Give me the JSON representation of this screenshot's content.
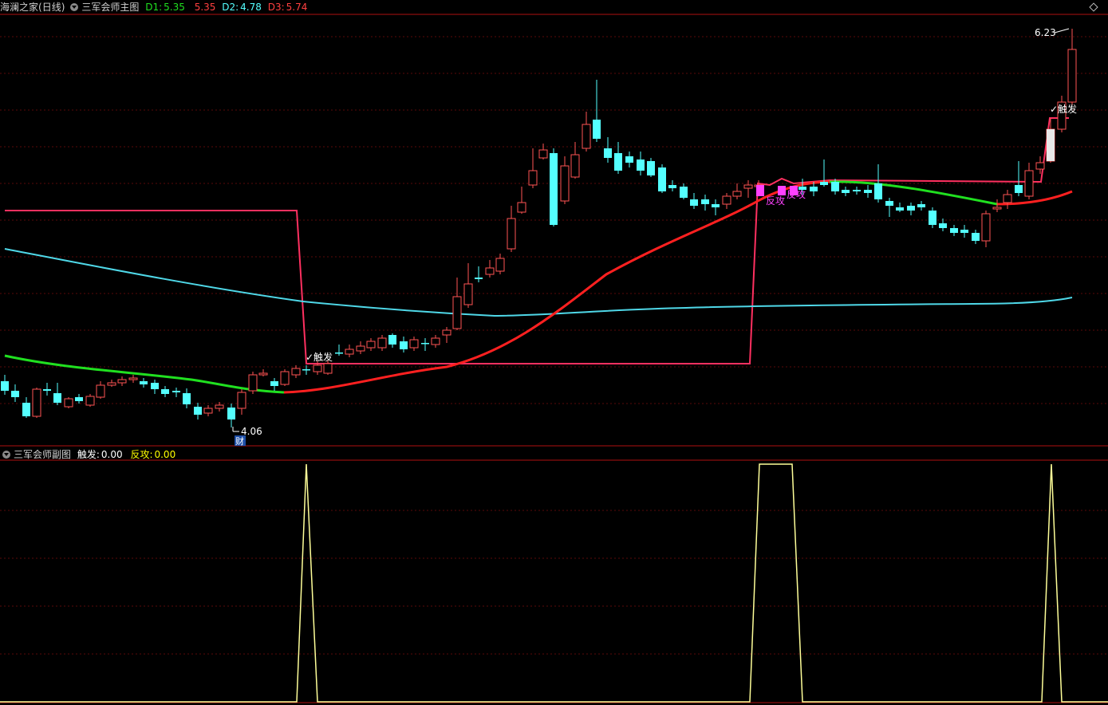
{
  "colors": {
    "background": "#000000",
    "grid": "#5a0a0a",
    "divider": "#b01010",
    "candle_up": "#ff5353",
    "candle_down": "#54ffff",
    "ma_slow": "#4fd8e8",
    "ma_fast_up": "#ff2020",
    "ma_fast_green": "#20e020",
    "stair_line": "#ff3060",
    "sub_line": "#ffff99",
    "d1": "#20e020",
    "d2": "#54ffff",
    "d3": "#ff4040",
    "chudfa": "#ffffff",
    "fangong": "#ffff00"
  },
  "main_header": {
    "stock_name": "海澜之家",
    "period": "(日线)",
    "indicator_name": "三军会师主图",
    "d1_label": "D1:",
    "d1_value": "5.35",
    "d1b_value": "5.35",
    "d2_label": "D2:",
    "d2_value": "4.78",
    "d3_label": "D3:",
    "d3_value": "5.74"
  },
  "sub_header": {
    "indicator_name": "三军会师副图",
    "chufa_label": "触发:",
    "chufa_value": "0.00",
    "fangong_label": "反攻:",
    "fangong_value": "0.00"
  },
  "annotations": {
    "high_price": "6.23",
    "low_price": "4.06",
    "trigger_1": "触发",
    "trigger_2": "触发",
    "fan_gong_text": "反攻",
    "cai_badge": "财"
  },
  "icons": [
    "collapse-main-icon",
    "collapse-sub-icon",
    "diamond-icon"
  ]
}
